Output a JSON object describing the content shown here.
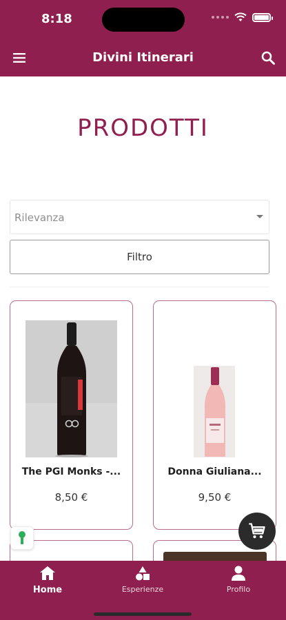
{
  "status": {
    "time": "8:18"
  },
  "header": {
    "title": "Divini Itinerari",
    "menu_icon": "menu-icon",
    "search_icon": "search-icon"
  },
  "page": {
    "title": "PRODOTTI"
  },
  "sort": {
    "selected": "Rilevanza"
  },
  "filter": {
    "label": "Filtro"
  },
  "products": [
    {
      "name": "The PGI Monks -...",
      "price": "8,50 €"
    },
    {
      "name": "Donna Giuliana...",
      "price": "9,50 €"
    }
  ],
  "tabs": [
    {
      "label": "Home",
      "icon": "home-icon"
    },
    {
      "label": "Esperienze",
      "icon": "shapes-icon"
    },
    {
      "label": "Profilo",
      "icon": "person-icon"
    }
  ],
  "colors": {
    "brand": "#8f1f4e",
    "card_border": "#b86b8e"
  }
}
